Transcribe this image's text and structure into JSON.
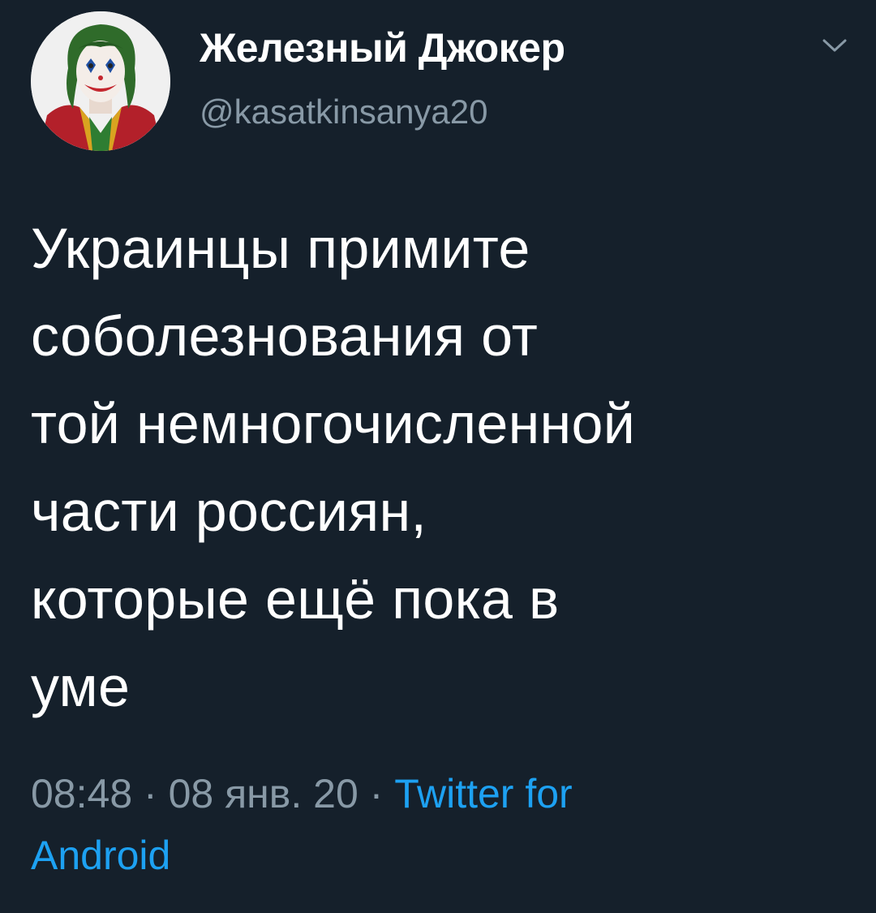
{
  "author": {
    "display_name": "Железный Джокер",
    "handle": "@kasatkinsanya20",
    "avatar_icon": "joker-avatar"
  },
  "menu_icon": "chevron-down-icon",
  "tweet": {
    "text_lines": [
      "Украинцы примите",
      "соболезнования от",
      "той немногочисленной",
      "части россиян,",
      "которые ещё пока в",
      "уме"
    ],
    "time": "08:48",
    "date": "08 янв. 20",
    "separator": "·",
    "source_line1": "Twitter for",
    "source_line2": "Android"
  },
  "colors": {
    "background": "#15202b",
    "text_primary": "#ffffff",
    "text_secondary": "#8899a6",
    "link": "#1da1f2"
  }
}
